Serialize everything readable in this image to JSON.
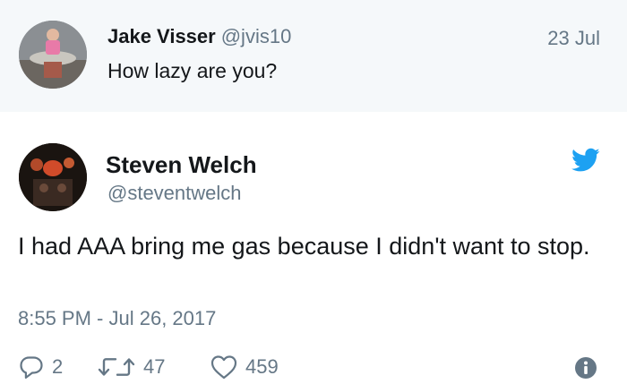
{
  "parent_tweet": {
    "author_name": "Jake Visser",
    "author_handle": "@jvis10",
    "date": "23 Jul",
    "text": "How lazy are you?"
  },
  "main_tweet": {
    "author_name": "Steven Welch",
    "author_handle": "@steventwelch",
    "text": "I had AAA bring me gas because I didn't want to stop.",
    "timestamp": "8:55 PM - Jul 26, 2017",
    "replies": "2",
    "retweets": "47",
    "likes": "459"
  },
  "icons": {
    "bird": "twitter-bird-icon",
    "reply": "reply-icon",
    "retweet": "retweet-icon",
    "like": "heart-icon",
    "info": "info-icon"
  },
  "colors": {
    "twitter_blue": "#1da1f2",
    "secondary_text": "#657786",
    "parent_background": "#f5f8fa"
  }
}
